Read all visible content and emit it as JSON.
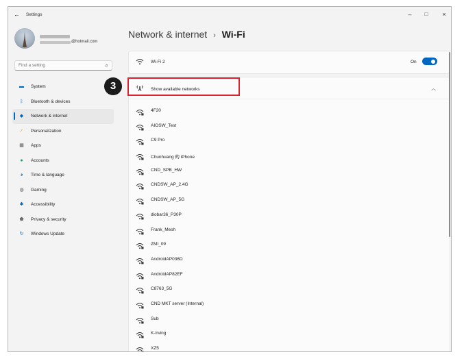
{
  "window": {
    "title": "Settings",
    "controls": {
      "minimize": "–",
      "maximize": "□",
      "close": "×"
    }
  },
  "profile": {
    "email_suffix": "@hotmail.com"
  },
  "search": {
    "placeholder": "Find a setting"
  },
  "sidebar": {
    "items": [
      {
        "label": "System",
        "icon": "system-icon",
        "color": "#0067c0",
        "active": false
      },
      {
        "label": "Bluetooth & devices",
        "icon": "bluetooth-icon",
        "color": "#0067c0",
        "active": false
      },
      {
        "label": "Network & internet",
        "icon": "network-icon",
        "color": "#0067c0",
        "active": true
      },
      {
        "label": "Personalization",
        "icon": "brush-icon",
        "color": "#e08b00",
        "active": false
      },
      {
        "label": "Apps",
        "icon": "apps-icon",
        "color": "#5a5a5a",
        "active": false
      },
      {
        "label": "Accounts",
        "icon": "accounts-icon",
        "color": "#1a9c5b",
        "active": false
      },
      {
        "label": "Time & language",
        "icon": "globe-icon",
        "color": "#0067c0",
        "active": false
      },
      {
        "label": "Gaming",
        "icon": "gamepad-icon",
        "color": "#5a5a5a",
        "active": false
      },
      {
        "label": "Accessibility",
        "icon": "accessibility-icon",
        "color": "#0067c0",
        "active": false
      },
      {
        "label": "Privacy & security",
        "icon": "shield-icon",
        "color": "#6d6d6d",
        "active": false
      },
      {
        "label": "Windows Update",
        "icon": "update-icon",
        "color": "#0067c0",
        "active": false
      }
    ]
  },
  "breadcrumb": {
    "parent": "Network & internet",
    "separator": "›",
    "current": "Wi-Fi"
  },
  "wifi": {
    "label": "Wi-Fi 2",
    "toggle_label": "On",
    "enabled": true,
    "accent": "#0067c0"
  },
  "networks": {
    "header_label": "Show available networks",
    "items": [
      "4F20",
      "AIOSW_Test",
      "C9 Pro",
      "Chunhuang 的 iPhone",
      "CND_SPB_HW",
      "CNDSW_AP_2.4G",
      "CNDSW_AP_5G",
      "diobar36_P30P",
      "Frank_Mesh",
      "ZMI_09",
      "AndroidAP036D",
      "AndroidAP82EF",
      "C8763_5G",
      "CND MKT server (Internal)",
      "Sub",
      "K-Irving",
      "XZ5"
    ]
  },
  "annotation": {
    "step": "3",
    "color": "#d9232e"
  }
}
